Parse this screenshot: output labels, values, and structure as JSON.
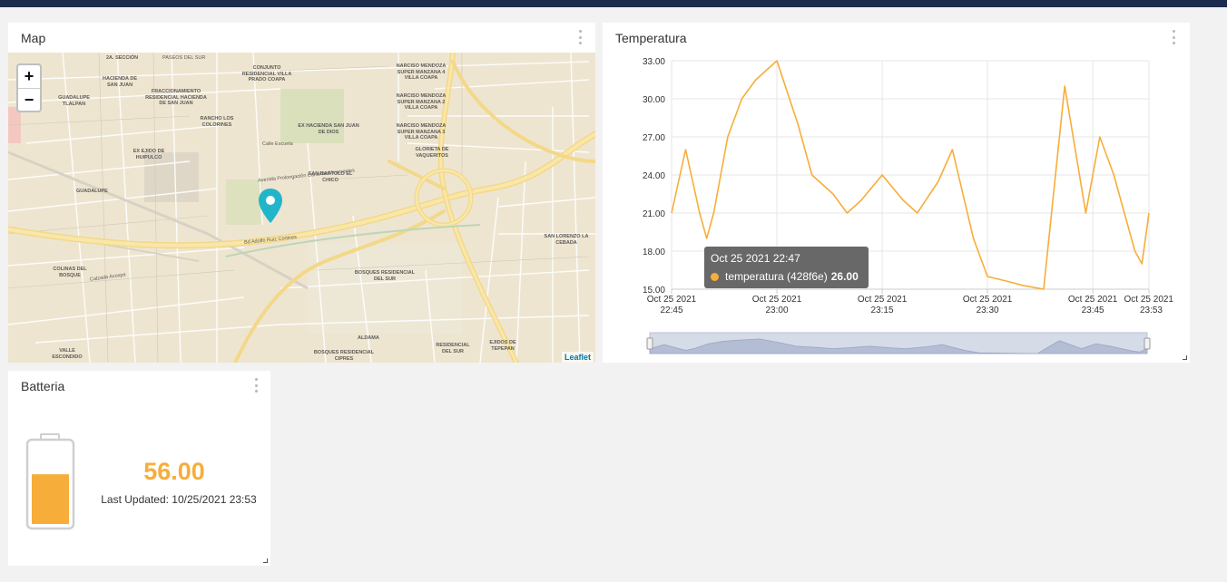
{
  "colors": {
    "topbar": "#1c2a4d",
    "accent": "#f7ad3a",
    "map_pin": "#21b5ca",
    "grid": "#e6e6e6"
  },
  "map_widget": {
    "title": "Map",
    "zoom_in": "+",
    "zoom_out": "−",
    "attribution": "Leaflet",
    "labels": [
      "2A. SECCIÓN",
      "PASEOS DEL SUR",
      "CONJUNTO RESIDENCIAL VILLA PRADO COAPA",
      "NARCISO MENDOZA SUPER MANZANA 4 VILLA COAPA",
      "HACIENDA DE SAN JUAN",
      "GUADALUPE TLALPAN",
      "FRACCIONAMIENTO RESIDENCIAL HACIENDA DE SAN JUAN",
      "NARCISO MENDOZA SUPER MANZANA 2 VILLA COAPA",
      "RANCHO LOS COLORINES",
      "EX HACIENDA SAN JUAN DE DIOS",
      "NARCISO MENDOZA SUPER MANZANA 3 VILLA COAPA",
      "EX EJIDO DE HUIPULCO",
      "GLORIETA DE VAQUERITOS",
      "SAN BARTOLO EL CHICO",
      "GUADALUPE",
      "SAN LORENZO LA CEBADA",
      "COLINAS DEL BOSQUE",
      "BOSQUES RESIDENCIAL DEL SUR",
      "VALLE ESCONDIDO",
      "ALDAMA",
      "BOSQUES RESIDENCIAL CIPRES",
      "RESIDENCIAL DEL SUR",
      "EJIDOS DE TEPEPAN",
      "Calle Escuela",
      "Bd Adolfo Ruiz Cortines",
      "Avenida Prolongación Canal de Miramontes",
      "Calzada Acoxpa"
    ]
  },
  "temp_widget": {
    "title": "Temperatura",
    "tooltip": {
      "time": "Oct 25 2021 22:47",
      "series": "temperatura (428f6e)",
      "value": "26.00"
    }
  },
  "chart_data": {
    "type": "line",
    "title": "Temperatura",
    "x_tick_labels": [
      [
        "Oct 25 2021",
        "22:45"
      ],
      [
        "Oct 25 2021",
        "23:00"
      ],
      [
        "Oct 25 2021",
        "23:15"
      ],
      [
        "Oct 25 2021",
        "23:30"
      ],
      [
        "Oct 25 2021",
        "23:45"
      ],
      [
        "Oct 25 2021",
        "23:53"
      ]
    ],
    "y_ticks": [
      "15.00",
      "18.00",
      "21.00",
      "24.00",
      "27.00",
      "30.00",
      "33.00"
    ],
    "ylim": [
      15,
      33
    ],
    "xlim": [
      "2021-10-25 22:45",
      "2021-10-25 23:53"
    ],
    "grid": true,
    "series": [
      {
        "name": "temperatura (428f6e)",
        "color": "#f7ad3a",
        "x": [
          "22:45",
          "22:47",
          "22:49",
          "22:50",
          "22:51",
          "22:53",
          "22:55",
          "22:57",
          "23:00",
          "23:03",
          "23:05",
          "23:08",
          "23:10",
          "23:12",
          "23:15",
          "23:18",
          "23:20",
          "23:23",
          "23:25",
          "23:28",
          "23:30",
          "23:33",
          "23:35",
          "23:38",
          "23:41",
          "23:44",
          "23:46",
          "23:48",
          "23:49",
          "23:51",
          "23:52",
          "23:53"
        ],
        "values": [
          21,
          26,
          21,
          19,
          21,
          27,
          30,
          31.5,
          33,
          28,
          24,
          22.5,
          21,
          22,
          24,
          22,
          21,
          23.5,
          26,
          19,
          16,
          15.6,
          15.3,
          15,
          31,
          21,
          27,
          24,
          22,
          18,
          17,
          21
        ]
      }
    ]
  },
  "battery_widget": {
    "title": "Batteria",
    "value": "56.00",
    "level_fraction": 0.56,
    "last_updated": "Last Updated: 10/25/2021 23:53"
  }
}
